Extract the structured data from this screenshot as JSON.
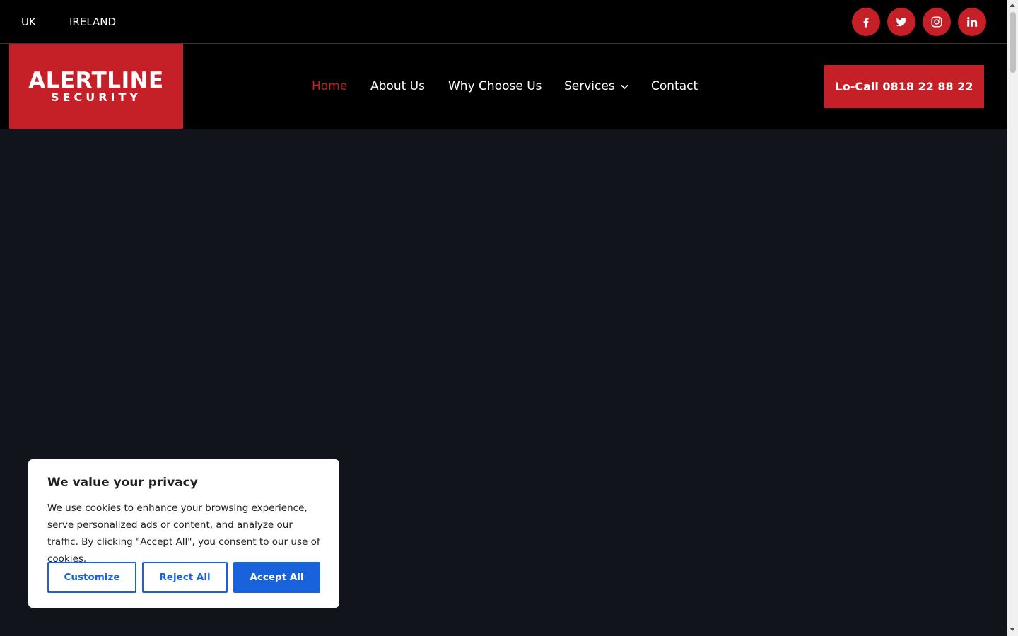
{
  "topbar": {
    "regions": [
      "UK",
      "IRELAND"
    ],
    "social": [
      "facebook-icon",
      "twitter-icon",
      "instagram-icon",
      "linkedin-icon"
    ]
  },
  "logo": {
    "line1": "ALERTLINE",
    "line2": "SECURITY"
  },
  "nav": {
    "items": [
      {
        "label": "Home",
        "active": true
      },
      {
        "label": "About Us",
        "active": false
      },
      {
        "label": "Why Choose Us",
        "active": false
      },
      {
        "label": "Services",
        "active": false,
        "dropdown": true
      },
      {
        "label": "Contact",
        "active": false
      }
    ],
    "cta_label": "Lo-Call 0818 22 88 22"
  },
  "cookie": {
    "title": "We value your privacy",
    "text": "We use cookies to enhance your browsing experience, serve personalized ads or content, and analyze our traffic. By clicking \"Accept All\", you consent to our use of cookies.",
    "customize": "Customize",
    "reject": "Reject All",
    "accept": "Accept All"
  },
  "colors": {
    "brand_red": "#c51f28",
    "header_bg": "#000000",
    "hero_bg": "#11141a",
    "cookie_blue": "#1863dc"
  }
}
